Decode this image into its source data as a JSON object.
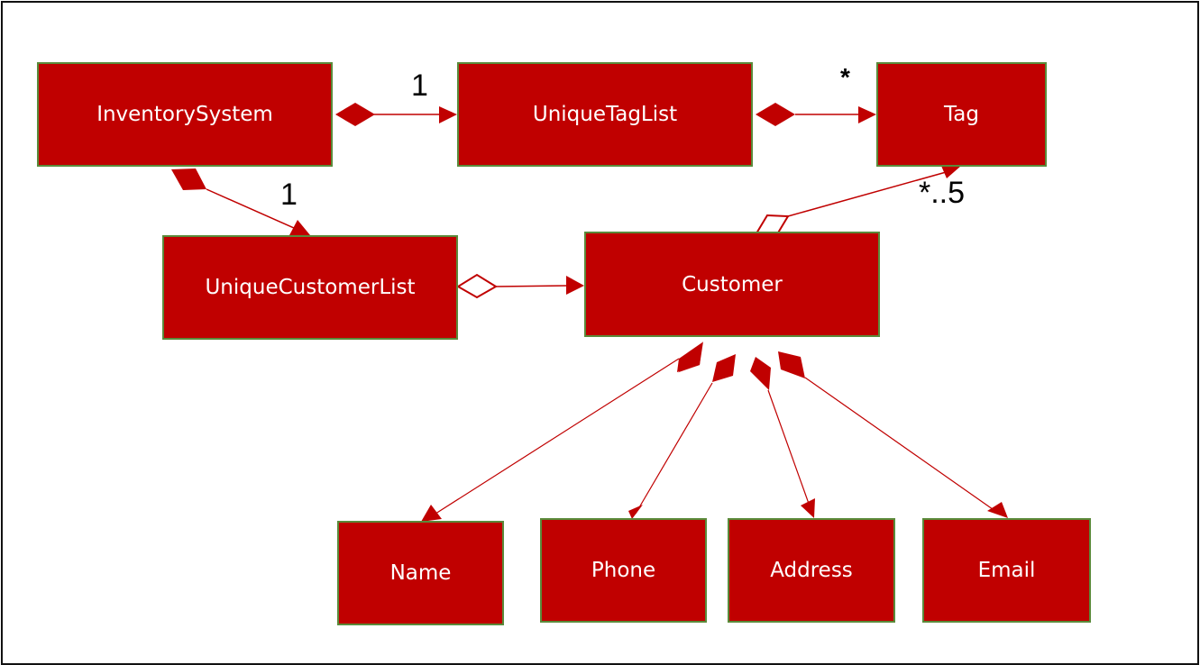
{
  "diagram": {
    "type": "UML class diagram",
    "colors": {
      "class_fill": "#c00000",
      "class_border": "#5a8a3a",
      "class_text": "#ffffff",
      "line": "#c00000"
    },
    "classes": {
      "inventory_system": "InventorySystem",
      "unique_tag_list": "UniqueTagList",
      "tag": "Tag",
      "unique_customer_list": "UniqueCustomerList",
      "customer": "Customer",
      "name": "Name",
      "phone": "Phone",
      "address": "Address",
      "email": "Email"
    },
    "relationships": [
      {
        "from": "InventorySystem",
        "to": "UniqueTagList",
        "kind": "composition",
        "multiplicity": "1"
      },
      {
        "from": "UniqueTagList",
        "to": "Tag",
        "kind": "composition",
        "multiplicity": "*"
      },
      {
        "from": "InventorySystem",
        "to": "UniqueCustomerList",
        "kind": "composition",
        "multiplicity": "1"
      },
      {
        "from": "UniqueCustomerList",
        "to": "Customer",
        "kind": "aggregation",
        "multiplicity": ""
      },
      {
        "from": "Customer",
        "to": "Tag",
        "kind": "aggregation",
        "multiplicity": "*..5"
      },
      {
        "from": "Customer",
        "to": "Name",
        "kind": "composition",
        "multiplicity": ""
      },
      {
        "from": "Customer",
        "to": "Phone",
        "kind": "composition",
        "multiplicity": ""
      },
      {
        "from": "Customer",
        "to": "Address",
        "kind": "composition",
        "multiplicity": ""
      },
      {
        "from": "Customer",
        "to": "Email",
        "kind": "composition",
        "multiplicity": ""
      }
    ],
    "multiplicities": {
      "inventory_to_taglist": "1",
      "taglist_to_tag": "*",
      "inventory_to_customerlist": "1",
      "customer_to_tag": "*..5"
    }
  }
}
